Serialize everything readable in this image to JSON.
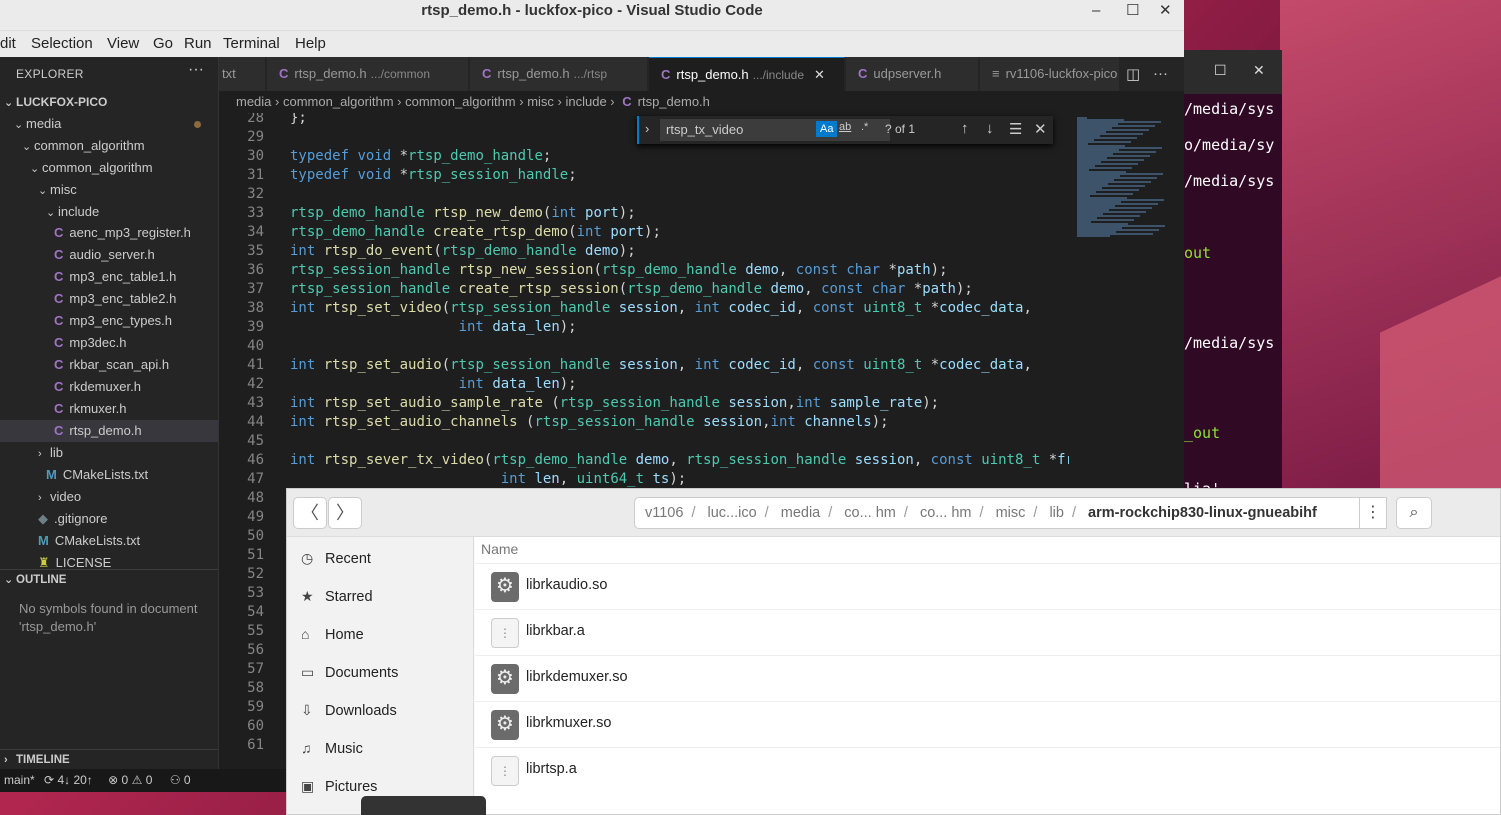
{
  "window": {
    "title": "rtsp_demo.h - luckfox-pico - Visual Studio Code",
    "controls": [
      "–",
      "☐",
      "✕"
    ]
  },
  "menu": [
    "dit",
    "Selection",
    "View",
    "Go",
    "Run",
    "Terminal",
    "Help"
  ],
  "explorer": {
    "title": "EXPLORER",
    "root": "LUCKFOX-PICO",
    "items": [
      {
        "label": "media",
        "kind": "folder-open"
      },
      {
        "label": "common_algorithm",
        "kind": "folder-open"
      },
      {
        "label": "common_algorithm",
        "kind": "folder-open"
      },
      {
        "label": "misc",
        "kind": "folder-open"
      },
      {
        "label": "include",
        "kind": "folder-open"
      },
      {
        "label": "aenc_mp3_register.h",
        "kind": "c"
      },
      {
        "label": "audio_server.h",
        "kind": "c"
      },
      {
        "label": "mp3_enc_table1.h",
        "kind": "c"
      },
      {
        "label": "mp3_enc_table2.h",
        "kind": "c"
      },
      {
        "label": "mp3_enc_types.h",
        "kind": "c"
      },
      {
        "label": "mp3dec.h",
        "kind": "c"
      },
      {
        "label": "rkbar_scan_api.h",
        "kind": "c"
      },
      {
        "label": "rkdemuxer.h",
        "kind": "c"
      },
      {
        "label": "rkmuxer.h",
        "kind": "c"
      },
      {
        "label": "rtsp_demo.h",
        "kind": "c"
      },
      {
        "label": "lib",
        "kind": "folder-closed"
      },
      {
        "label": "CMakeLists.txt",
        "kind": "cmake"
      },
      {
        "label": "video",
        "kind": "folder-closed"
      },
      {
        "label": ".gitignore",
        "kind": "git"
      },
      {
        "label": "CMakeLists.txt",
        "kind": "cmake"
      },
      {
        "label": "LICENSE",
        "kind": "license"
      }
    ],
    "outline_title": "OUTLINE",
    "outline_msg": "No symbols found in document 'rtsp_demo.h'",
    "timeline_title": "TIMELINE"
  },
  "tabs": [
    {
      "label": "txt",
      "desc": ""
    },
    {
      "label": "rtsp_demo.h",
      "desc": ".../common"
    },
    {
      "label": "rtsp_demo.h",
      "desc": ".../rtsp"
    },
    {
      "label": "rtsp_demo.h",
      "desc": ".../include"
    },
    {
      "label": "udpserver.h",
      "desc": ""
    },
    {
      "label": "rv1106-luckfox-pico",
      "desc": ""
    }
  ],
  "breadcrumb": [
    "media",
    "common_algorithm",
    "common_algorithm",
    "misc",
    "include",
    "rtsp_demo.h"
  ],
  "find": {
    "value": "rtsp_tx_video",
    "opt_case": "Aa",
    "opt_word": "ab",
    "opt_regex": ".*",
    "count": "? of 1"
  },
  "code_lines": [
    {
      "n": "28",
      "t": "};"
    },
    {
      "n": "29",
      "t": ""
    },
    {
      "n": "30",
      "t": "typedef void *rtsp_demo_handle;"
    },
    {
      "n": "31",
      "t": "typedef void *rtsp_session_handle;"
    },
    {
      "n": "32",
      "t": ""
    },
    {
      "n": "33",
      "t": "rtsp_demo_handle rtsp_new_demo(int port);"
    },
    {
      "n": "34",
      "t": "rtsp_demo_handle create_rtsp_demo(int port);"
    },
    {
      "n": "35",
      "t": "int rtsp_do_event(rtsp_demo_handle demo);"
    },
    {
      "n": "36",
      "t": "rtsp_session_handle rtsp_new_session(rtsp_demo_handle demo, const char *path);"
    },
    {
      "n": "37",
      "t": "rtsp_session_handle create_rtsp_session(rtsp_demo_handle demo, const char *path);"
    },
    {
      "n": "38",
      "t": "int rtsp_set_video(rtsp_session_handle session, int codec_id, const uint8_t *codec_data,"
    },
    {
      "n": "39",
      "t": "                    int data_len);"
    },
    {
      "n": "40",
      "t": ""
    },
    {
      "n": "41",
      "t": "int rtsp_set_audio(rtsp_session_handle session, int codec_id, const uint8_t *codec_data,"
    },
    {
      "n": "42",
      "t": "                    int data_len);"
    },
    {
      "n": "43",
      "t": "int rtsp_set_audio_sample_rate (rtsp_session_handle session,int sample_rate);"
    },
    {
      "n": "44",
      "t": "int rtsp_set_audio_channels (rtsp_session_handle session,int channels);"
    },
    {
      "n": "45",
      "t": ""
    },
    {
      "n": "46",
      "t": "int rtsp_sever_tx_video(rtsp_demo_handle demo, rtsp_session_handle session, const uint8_t *fr"
    },
    {
      "n": "47",
      "t": "                         int len, uint64_t ts);"
    },
    {
      "n": "48",
      "t": ""
    },
    {
      "n": "49",
      "t": ""
    },
    {
      "n": "50",
      "t": ""
    },
    {
      "n": "51",
      "t": ""
    },
    {
      "n": "52",
      "t": ""
    },
    {
      "n": "53",
      "t": ""
    },
    {
      "n": "54",
      "t": ""
    },
    {
      "n": "55",
      "t": ""
    },
    {
      "n": "56",
      "t": ""
    },
    {
      "n": "57",
      "t": ""
    },
    {
      "n": "58",
      "t": ""
    },
    {
      "n": "59",
      "t": ""
    },
    {
      "n": "60",
      "t": ""
    },
    {
      "n": "61",
      "t": ""
    }
  ],
  "status": {
    "branch": "main*",
    "sync": "4↓ 20↑",
    "problems": "0",
    "warnings": "0",
    "ports": "0"
  },
  "terminal_lines": [
    "/media/sys",
    "o/media/sy",
    "/media/sys",
    "out",
    "/media/sys",
    "_out",
    "lia'"
  ],
  "files": {
    "path": [
      "v1106",
      "luc...ico",
      "media",
      "co... hm",
      "co... hm",
      "misc",
      "lib",
      "arm-rockchip830-linux-gnueabihf"
    ],
    "places": [
      "Recent",
      "Starred",
      "Home",
      "Documents",
      "Downloads",
      "Music",
      "Pictures"
    ],
    "column_name": "Name",
    "entries": [
      {
        "name": "librkaudio.so",
        "type": "shared-library"
      },
      {
        "name": "librkbar.a",
        "type": "archive"
      },
      {
        "name": "librkdemuxer.so",
        "type": "shared-library"
      },
      {
        "name": "librkmuxer.so",
        "type": "shared-library"
      },
      {
        "name": "librtsp.a",
        "type": "archive"
      }
    ]
  }
}
